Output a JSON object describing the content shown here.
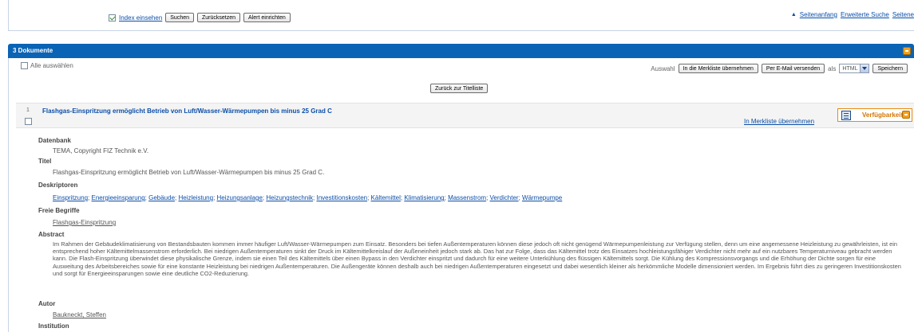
{
  "search": {
    "index_label": "Index einsehen",
    "search_button": "Suchen",
    "reset_button": "Zurücksetzen",
    "alert_button": "Alert einrichten",
    "links": [
      "Seitenanfang",
      "Erweiterte Suche",
      "Seitene"
    ]
  },
  "documents": {
    "header_title": "3 Dokumente",
    "select_all": "Alle auswählen",
    "auswahl_label": "Auswahl",
    "merkliste_button": "In die Merkliste übernehmen",
    "email_button": "Per E-Mail versenden",
    "als_label": "als",
    "format_value": "HTML",
    "save_button": "Speichern",
    "back_button": "Zurück zur Titelliste"
  },
  "result": {
    "number": "1",
    "title": "Flashgas-Einspritzung ermöglicht Betrieb von Luft/Wasser-Wärmepumpen bis minus 25 Grad C",
    "merkliste_link": "In Merkliste übernehmen",
    "availability_label": "Verfügbarkeit"
  },
  "detail": {
    "datenbank_label": "Datenbank",
    "datenbank_value": "TEMA, Copyright FIZ Technik e.V.",
    "titel_label": "Titel",
    "titel_value": "Flashgas-Einspritzung ermöglicht Betrieb von Luft/Wasser-Wärmepumpen bis minus 25 Grad C.",
    "deskriptoren_label": "Deskriptoren",
    "deskriptoren": [
      "Einspritzung",
      "Energieeinsparung",
      "Gebäude",
      "Heizleistung",
      "Heizungsanlage",
      "Heizungstechnik",
      "Investitionskosten",
      "Kältemittel",
      "Klimatisierung",
      "Massenstrom",
      "Verdichter",
      "Wärmepumpe"
    ],
    "freie_label": "Freie Begriffe",
    "freie_value": "Flashgas-Einspritzung",
    "abstract_label": "Abstract",
    "abstract_value": "Im Rahmen der Gebäudeklimatisierung von Bestandsbauten kommen immer häufiger Luft/Wasser-Wärmepumpen zum Einsatz. Besonders bei tiefen Außentemperaturen können diese jedoch oft nicht genügend Wärmepumpenleistung zur Verfügung stellen, denn um eine angemessene Heizleistung zu gewährleisten, ist ein entsprechend hoher Kältemittelmassenstrom erforderlich. Bei niedrigen Außentemperaturen sinkt der Druck im Kältemittelkreislauf der Außeneinheit jedoch stark ab. Das hat zur Folge, dass das Kältemittel trotz des Einsatzes hochleistungsfähiger Verdichter nicht mehr auf ein nutzbares Temperaturniveau gebracht werden kann. Die Flash-Einspritzung überwindet diese physikalische Grenze, indem sie einen Teil des Kältemittels über einen Bypass in den Verdichter einspritzt und dadurch für eine weitere Unterkühlung des flüssigen Kältemittels sorgt. Die Kühlung des Kompressionsvorgangs und die Erhöhung der Dichte sorgen für eine Ausweitung des Arbeitsbereiches sowie für eine konstante Heizleistung bei niedrigen Außentemperaturen. Die Außengeräte können deshalb auch bei niedrigen Außentemperaturen eingesetzt und dabei wesentlich kleiner als herkömmliche Modelle dimensioniert werden. Im Ergebnis führt dies zu geringeren Investitionskosten und sorgt für Energieeinsparungen sowie eine deutliche CO2-Reduzierung.",
    "autor_label": "Autor",
    "autor_value": "Baukneckt, Steffen",
    "institution_label": "Institution"
  }
}
